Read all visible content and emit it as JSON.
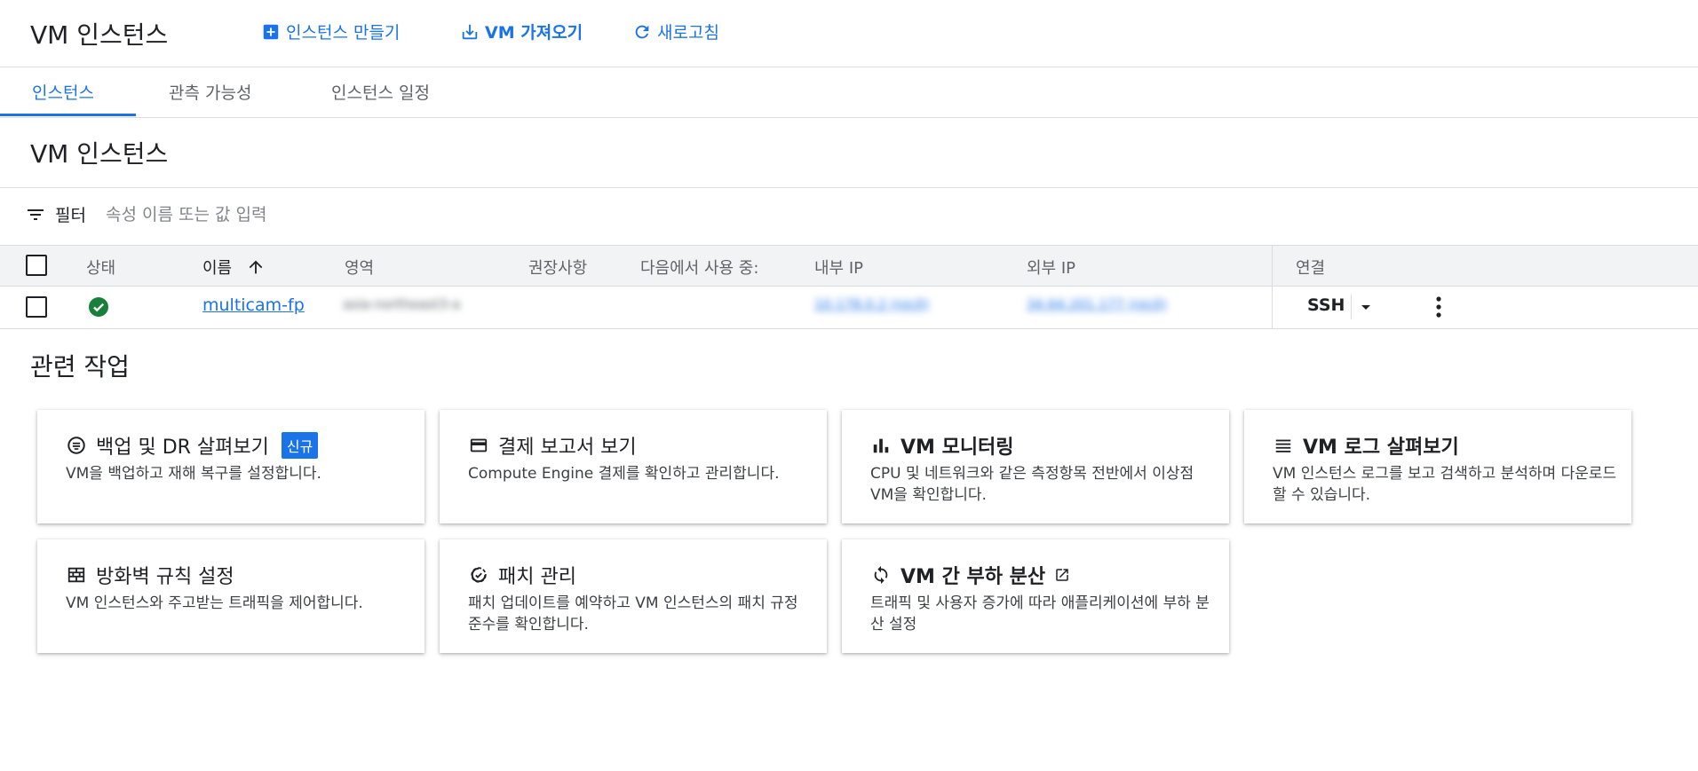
{
  "header": {
    "title": "VM 인스턴스",
    "create_label": "인스턴스 만들기",
    "import_label": "VM 가져오기",
    "refresh_label": "새로고침"
  },
  "tabs": [
    {
      "label": "인스턴스",
      "active": true
    },
    {
      "label": "관측 가능성",
      "active": false
    },
    {
      "label": "인스턴스 일정",
      "active": false
    }
  ],
  "section_title": "VM 인스턴스",
  "filter": {
    "label": "필터",
    "placeholder": "속성 이름 또는 값 입력"
  },
  "table": {
    "columns": {
      "status": "상태",
      "name": "이름",
      "zone": "영역",
      "recommendation": "권장사항",
      "in_use_by": "다음에서 사용 중:",
      "internal_ip": "내부 IP",
      "external_ip": "외부 IP",
      "connect": "연결"
    },
    "rows": [
      {
        "status": "running",
        "name": "multicam-fp",
        "zone": "asia-northeast3-a",
        "internal_ip": "10.178.0.2 (nic0)",
        "external_ip": "34.64.201.177 (nic0)",
        "connect": "SSH"
      }
    ]
  },
  "related": {
    "title": "관련 작업",
    "cards": [
      {
        "icon": "backup-icon",
        "title": "백업 및 DR 살펴보기",
        "badge": "신규",
        "desc": "VM을 백업하고 재해 복구를 설정합니다."
      },
      {
        "icon": "billing-card-icon",
        "title": "결제 보고서 보기",
        "desc": "Compute Engine 결제를 확인하고 관리합니다."
      },
      {
        "icon": "bar-chart-icon",
        "title": "VM 모니터링",
        "desc": "CPU 및 네트워크와 같은 측정항목 전반에서 이상점 VM을 확인합니다."
      },
      {
        "icon": "list-icon",
        "title": "VM 로그 살펴보기",
        "desc": "VM 인스턴스 로그를 보고 검색하고 분석하며 다운로드할 수 있습니다."
      },
      {
        "icon": "firewall-icon",
        "title": "방화벽 규칙 설정",
        "desc": "VM 인스턴스와 주고받는 트래픽을 제어합니다."
      },
      {
        "icon": "patch-icon",
        "title": "패치 관리",
        "desc": "패치 업데이트를 예약하고 VM 인스턴스의 패치 규정 준수를 확인합니다."
      },
      {
        "icon": "load-balance-icon",
        "title": "VM 간 부하 분산",
        "desc": "트래픽 및 사용자 증가에 따라 애플리케이션에 부하 분산 설정"
      }
    ]
  },
  "colors": {
    "accent": "#1a73e8",
    "status_ok": "#188038",
    "header_bg": "#f1f3f4"
  }
}
